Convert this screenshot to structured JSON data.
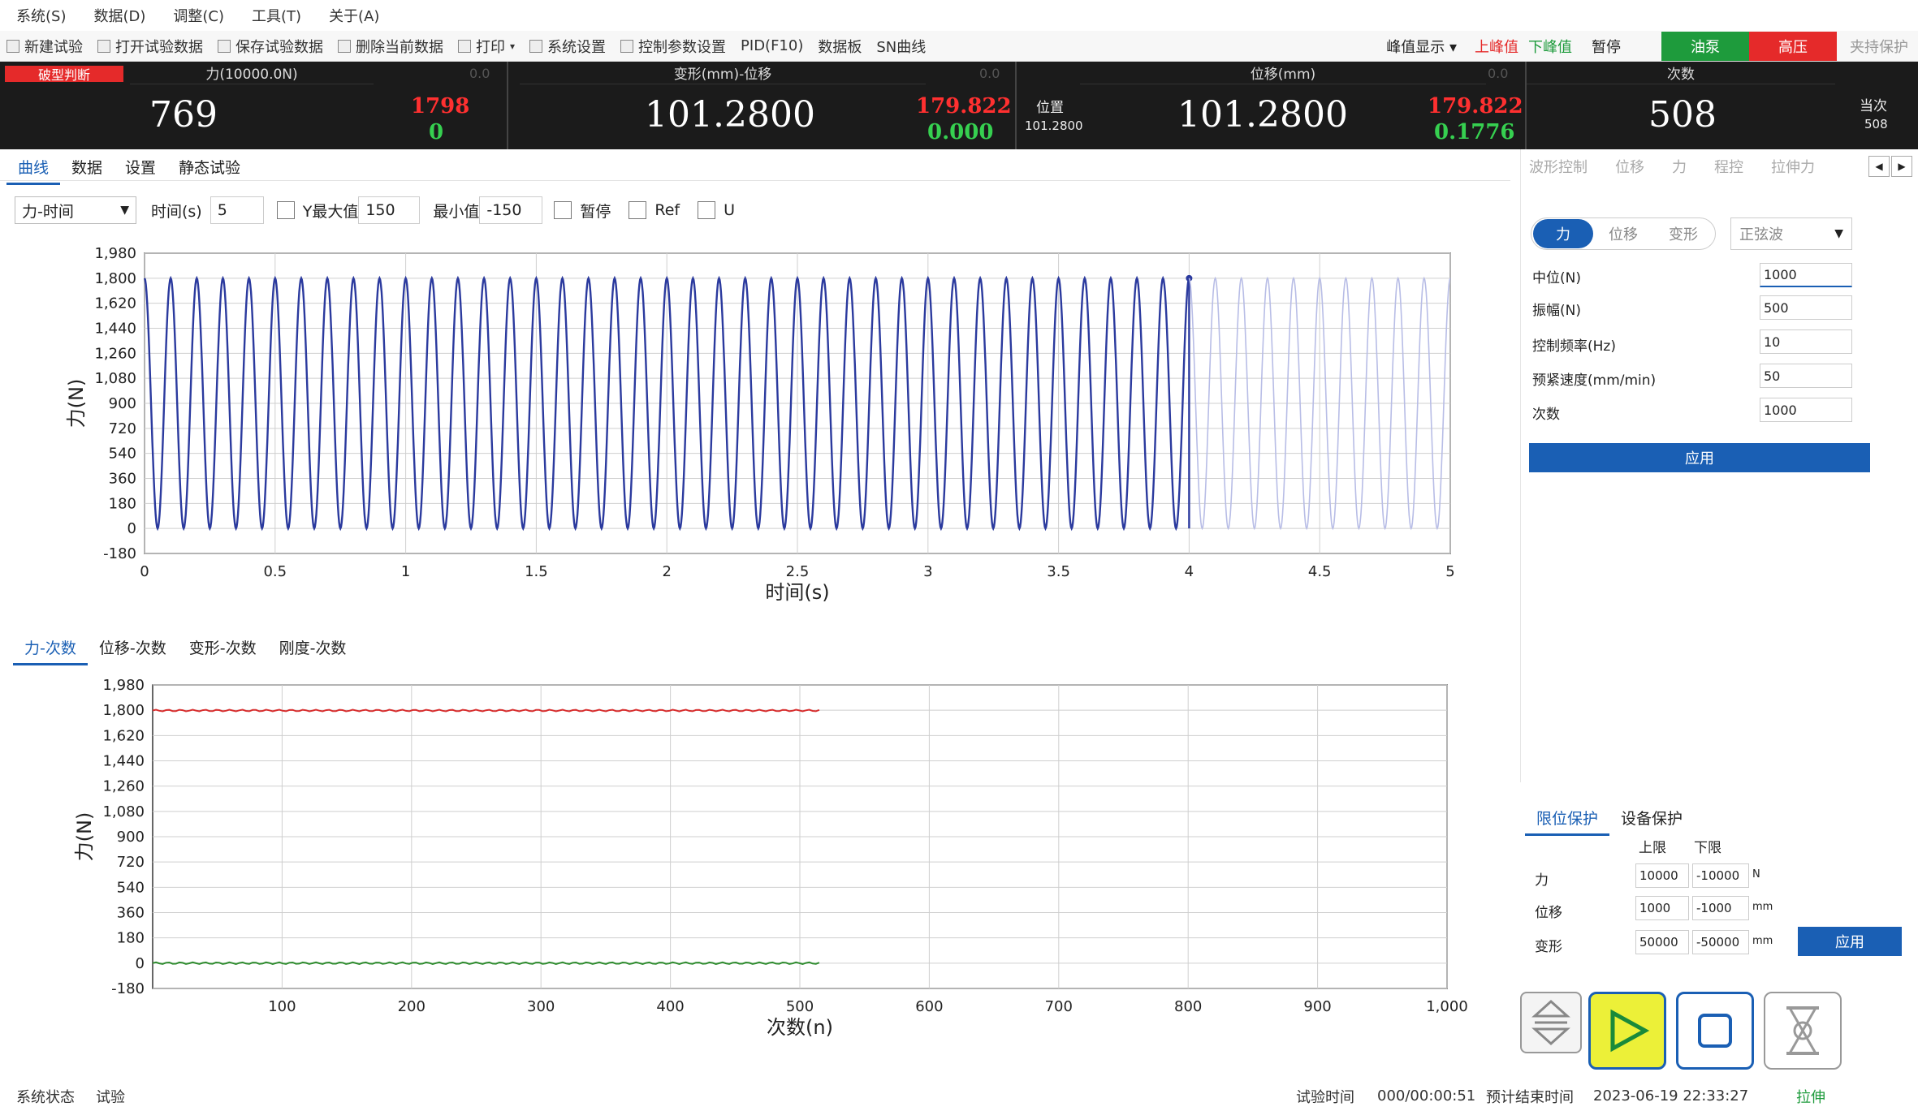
{
  "menu": [
    "系统(S)",
    "数据(D)",
    "调整(C)",
    "工具(T)",
    "关于(A)"
  ],
  "toolbar": {
    "items": [
      "新建试验",
      "打开试验数据",
      "保存试验数据",
      "删除当前数据",
      "打印",
      "系统设置",
      "控制参数设置",
      "PID(F10)",
      "数据板",
      "SN曲线"
    ],
    "peak_display": "峰值显示",
    "upper_peak": "上峰值",
    "lower_peak": "下峰值",
    "pause": "暂停",
    "oil_pump": "油泵",
    "high_pressure": "高压",
    "clamp_protect": "夹持保护"
  },
  "readout": {
    "break_judge": "破型判断",
    "force_header": "力(10000.0N)",
    "force_zero": "0.0",
    "deform_header": "变形(mm)-位移",
    "deform_zero": "0.0",
    "disp_header": "位移(mm)",
    "disp_zero": "0.0",
    "count_header": "次数",
    "force_value": "769",
    "force_upper": "1798",
    "force_lower": "0",
    "deform_value": "101.2800",
    "deform_upper": "179.822",
    "deform_lower": "0.000",
    "pos_label": "位置",
    "pos_value": "101.2800",
    "disp_value": "101.2800",
    "disp_upper": "179.822",
    "disp_lower": "0.1776",
    "count_value": "508",
    "current_label": "当次",
    "current_value": "508"
  },
  "main_tabs": [
    "曲线",
    "数据",
    "设置",
    "静态试验"
  ],
  "curve_controls": {
    "mode": "力-时间",
    "time_label": "时间(s)",
    "time_value": "5",
    "ymax_label": "Y最大值",
    "ymax_value": "150",
    "ymin_label": "最小值",
    "ymin_value": "-150",
    "pause": "暂停",
    "ref": "Ref",
    "u": "U"
  },
  "chart_data": [
    {
      "type": "line",
      "title": "",
      "xlabel": "时间(s)",
      "ylabel": "力(N)",
      "xlim": [
        0,
        5
      ],
      "ylim": [
        -180,
        1980
      ],
      "x_ticks": [
        "0",
        "0.5",
        "1",
        "1.5",
        "2",
        "2.5",
        "3",
        "3.5",
        "4",
        "4.5",
        "5"
      ],
      "y_ticks": [
        "1,980",
        "1,800",
        "1,620",
        "1,440",
        "1,260",
        "1,080",
        "900",
        "720",
        "540",
        "360",
        "180",
        "0",
        "-180"
      ],
      "series": [
        {
          "mean": 900,
          "amplitude": 900,
          "frequency_hz": 10,
          "x_end": 4.0,
          "color": "#2b3a9e"
        },
        {
          "mean": 900,
          "amplitude": 900,
          "frequency_hz": 10,
          "x_start": 4.0,
          "x_end": 5.0,
          "color": "#b8bde6"
        }
      ]
    },
    {
      "type": "line",
      "title": "",
      "xlabel": "次数(n)",
      "ylabel": "力(N)",
      "xlim": [
        0,
        1000
      ],
      "ylim": [
        -180,
        1980
      ],
      "x_ticks": [
        "100",
        "200",
        "300",
        "400",
        "500",
        "600",
        "700",
        "800",
        "900",
        "1,000"
      ],
      "y_ticks": [
        "1,980",
        "1,800",
        "1,620",
        "1,440",
        "1,260",
        "1,080",
        "900",
        "720",
        "540",
        "360",
        "180",
        "0",
        "-180"
      ],
      "series": [
        {
          "values_const": 1798,
          "x_start": 0,
          "x_end": 515,
          "color": "#d83030"
        },
        {
          "values_const": 0,
          "x_start": 0,
          "x_end": 515,
          "color": "#2e8b2e"
        }
      ]
    }
  ],
  "bottom_tabs": [
    "力-次数",
    "位移-次数",
    "变形-次数",
    "刚度-次数"
  ],
  "right_tabs": [
    "波形控制",
    "位移",
    "力",
    "程控",
    "拉伸力"
  ],
  "wave": {
    "seg": [
      "力",
      "位移",
      "变形"
    ],
    "wave_type": "正弦波",
    "fields": [
      {
        "label": "中位(N)",
        "value": "1000"
      },
      {
        "label": "振幅(N)",
        "value": "500"
      },
      {
        "label": "控制频率(Hz)",
        "value": "10"
      },
      {
        "label": "预紧速度(mm/min)",
        "value": "50"
      },
      {
        "label": "次数",
        "value": "1000"
      }
    ],
    "apply": "应用"
  },
  "protect": {
    "tabs": [
      "限位保护",
      "设备保护"
    ],
    "upper": "上限",
    "lower": "下限",
    "rows": [
      {
        "label": "力",
        "up": "10000",
        "low": "-10000",
        "unit": "N"
      },
      {
        "label": "位移",
        "up": "1000",
        "low": "-1000",
        "unit": "mm"
      },
      {
        "label": "变形",
        "up": "50000",
        "low": "-50000",
        "unit": "mm"
      }
    ],
    "apply": "应用"
  },
  "status": {
    "state_label": "系统状态",
    "state_value": "试验",
    "time_label": "试验时间",
    "time_value": "000/00:00:51",
    "end_label": "预计结束时间",
    "end_value": "2023-06-19 22:33:27",
    "mode": "拉伸"
  }
}
